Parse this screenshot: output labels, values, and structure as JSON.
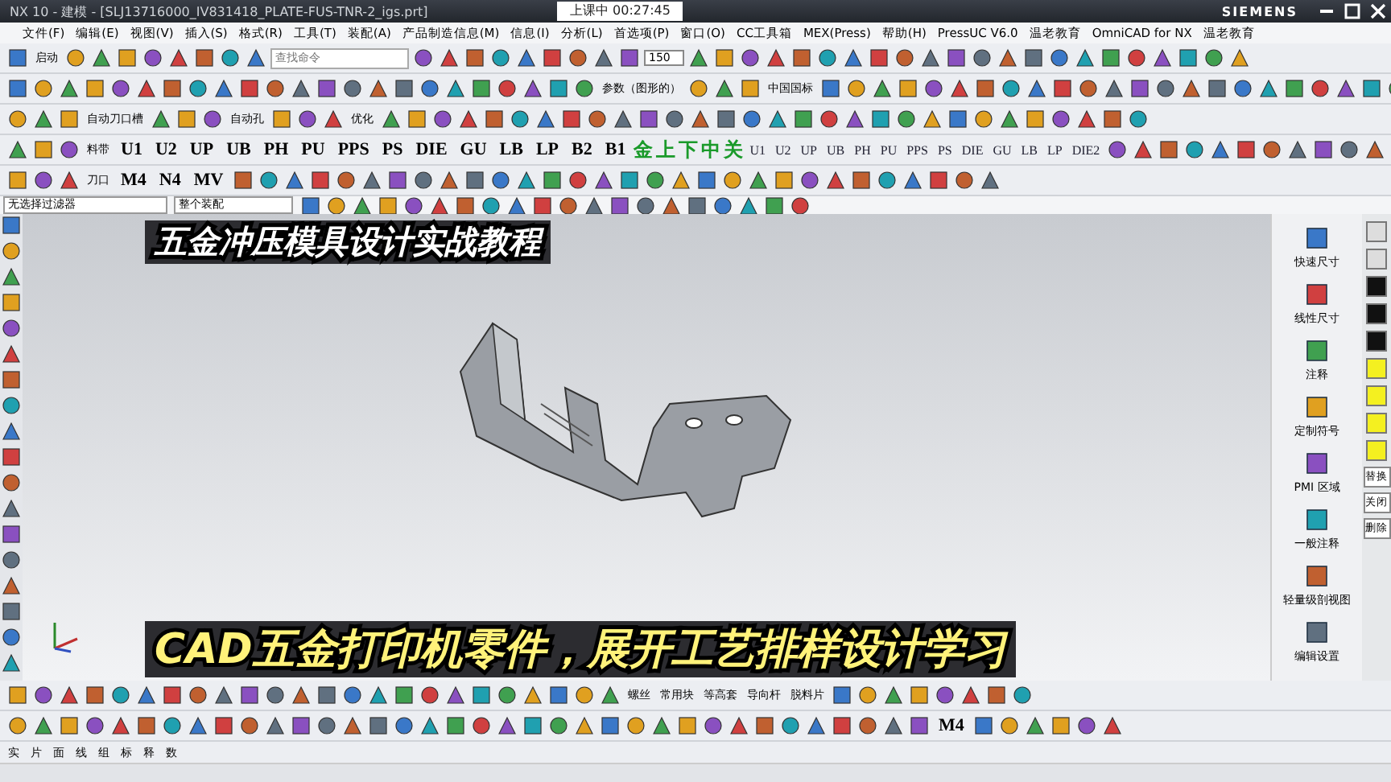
{
  "window": {
    "title": "NX 10 - 建模 - [SLJ13716000_IV831418_PLATE-FUS-TNR-2_igs.prt]",
    "timer": "上课中 00:27:45",
    "brand": "SIEMENS"
  },
  "menu": [
    "文件(F)",
    "编辑(E)",
    "视图(V)",
    "插入(S)",
    "格式(R)",
    "工具(T)",
    "装配(A)",
    "产品制造信息(M)",
    "信息(I)",
    "分析(L)",
    "首选项(P)",
    "窗口(O)",
    "CC工具箱",
    "MEX(Press)",
    "帮助(H)",
    "PressUC V6.0",
    "温老教育",
    "OmniCAD for NX",
    "温老教育"
  ],
  "top_toolbar": {
    "start": "启动",
    "search": {
      "placeholder": "查找命令"
    },
    "scale": "150"
  },
  "toolbars": [
    {
      "items": [
        {
          "kind": "plain",
          "text": "参数（图形的）"
        },
        {
          "kind": "plain",
          "text": "中国国标"
        }
      ]
    },
    {
      "items": [
        {
          "kind": "plain",
          "text": "自动刀口槽"
        },
        {
          "kind": "plain",
          "text": "自动孔"
        },
        {
          "kind": "plain",
          "text": "优化"
        }
      ]
    },
    {
      "items": [
        {
          "kind": "plain",
          "text": "料带"
        },
        {
          "kind": "code",
          "text": "U1"
        },
        {
          "kind": "code",
          "text": "U2"
        },
        {
          "kind": "code",
          "text": "UP"
        },
        {
          "kind": "code",
          "text": "UB"
        },
        {
          "kind": "code",
          "text": "PH"
        },
        {
          "kind": "code",
          "text": "PU"
        },
        {
          "kind": "code",
          "text": "PPS"
        },
        {
          "kind": "code",
          "text": "PS"
        },
        {
          "kind": "code",
          "text": "DIE"
        },
        {
          "kind": "code",
          "text": "GU"
        },
        {
          "kind": "code",
          "text": "LB"
        },
        {
          "kind": "code",
          "text": "LP"
        },
        {
          "kind": "code",
          "text": "B2"
        },
        {
          "kind": "code",
          "text": "B1"
        },
        {
          "kind": "green",
          "text": "金"
        },
        {
          "kind": "green",
          "text": "上"
        },
        {
          "kind": "green",
          "text": "下"
        },
        {
          "kind": "green",
          "text": "中"
        },
        {
          "kind": "green",
          "text": "关"
        },
        {
          "kind": "small",
          "text": "U1"
        },
        {
          "kind": "small",
          "text": "U2"
        },
        {
          "kind": "small",
          "text": "UP"
        },
        {
          "kind": "small",
          "text": "UB"
        },
        {
          "kind": "small",
          "text": "PH"
        },
        {
          "kind": "small",
          "text": "PU"
        },
        {
          "kind": "small",
          "text": "PPS"
        },
        {
          "kind": "small",
          "text": "PS"
        },
        {
          "kind": "small",
          "text": "DIE"
        },
        {
          "kind": "small",
          "text": "GU"
        },
        {
          "kind": "small",
          "text": "LB"
        },
        {
          "kind": "small",
          "text": "LP"
        },
        {
          "kind": "small",
          "text": "DIE2"
        }
      ]
    },
    {
      "items": [
        {
          "kind": "plain",
          "text": "刀口"
        },
        {
          "kind": "code",
          "text": "M4"
        },
        {
          "kind": "code",
          "text": "N4"
        },
        {
          "kind": "code",
          "text": "MV"
        }
      ]
    }
  ],
  "filters": [
    "无选择过滤器",
    "整个装配"
  ],
  "captions": [
    "五金冲压模具设计实战教程",
    "CAD五金打印机零件，展开工艺排样设计学习"
  ],
  "pmi_panel": [
    "快速尺寸",
    "线性尺寸",
    "注释",
    "定制符号",
    "PMI 区域",
    "一般注释",
    "轻量级剖视图",
    "编辑设置"
  ],
  "side_strip": [
    "替换",
    "关闭",
    "删除"
  ],
  "bottom_toolbars": [
    {
      "labels": [
        "螺丝",
        "常用块",
        "等高套",
        "导向杆",
        "脱料片"
      ]
    },
    {
      "labels": [
        "M4"
      ]
    }
  ],
  "bottom_tabs": [
    "实",
    "片",
    "面",
    "线",
    "组",
    "标",
    "释",
    "数"
  ]
}
